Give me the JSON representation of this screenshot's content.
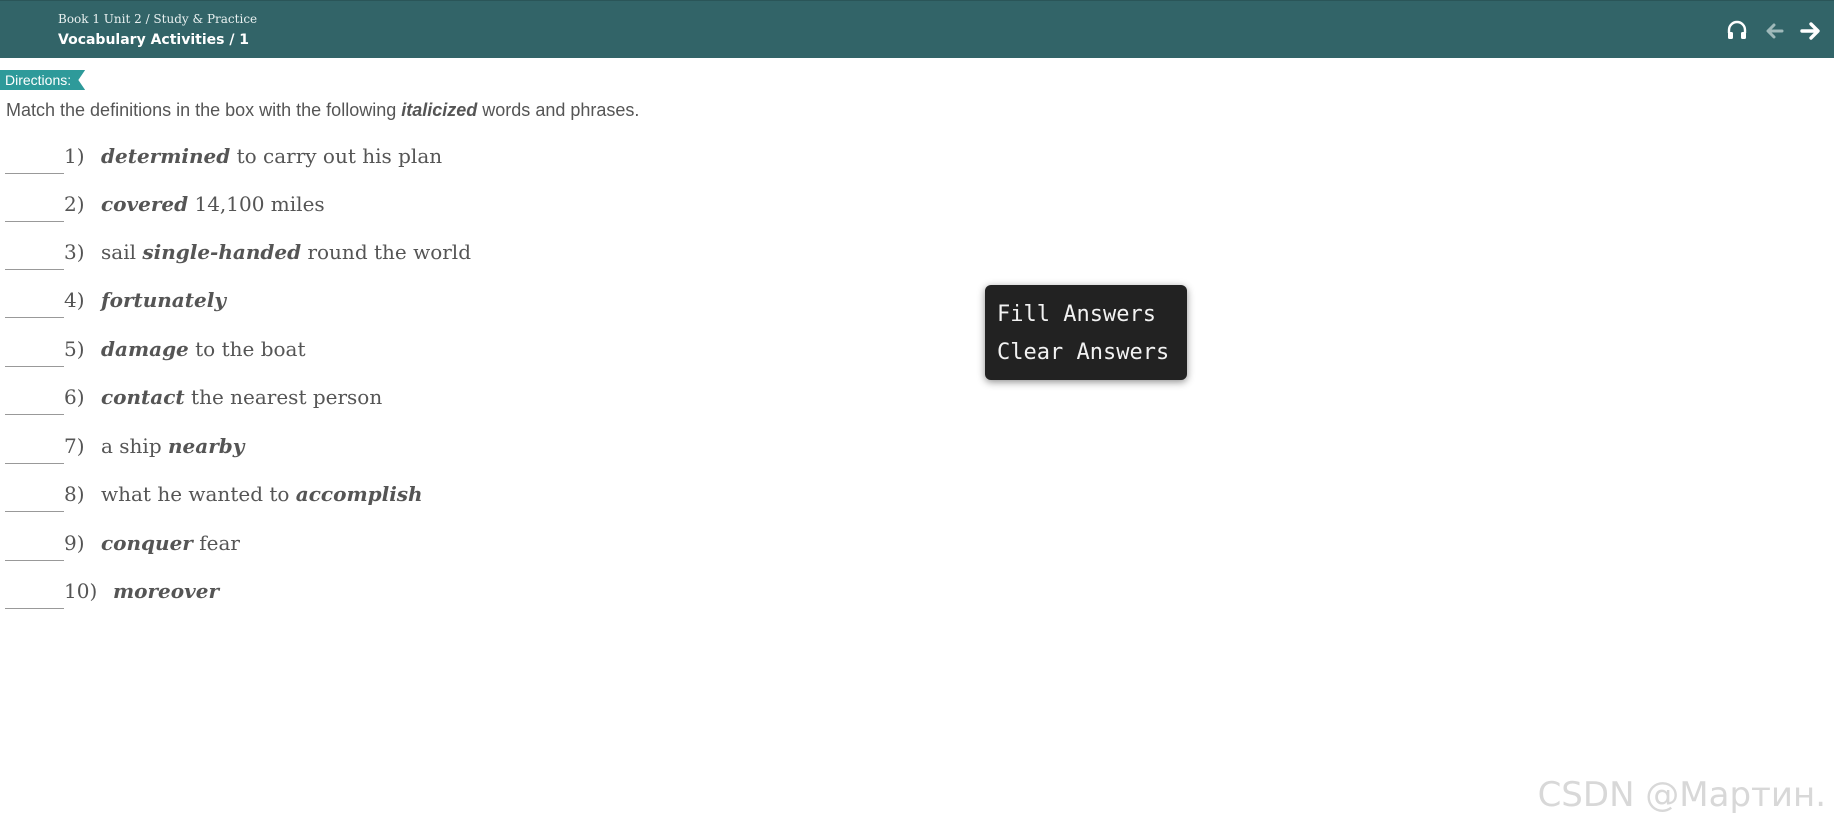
{
  "header": {
    "breadcrumb": "Book 1 Unit 2 / Study & Practice",
    "title": "Vocabulary Activities / 1",
    "icons": [
      "headphones-icon",
      "arrow-left-icon",
      "arrow-right-icon"
    ]
  },
  "directions": {
    "label": "Directions:",
    "text_before": "Match the definitions in the box with the following",
    "text_emph": "italicized",
    "text_after": "words and phrases."
  },
  "items": [
    {
      "num": "1)",
      "pre": "",
      "kw": "determined",
      "post": "to carry out his plan"
    },
    {
      "num": "2)",
      "pre": "",
      "kw": "covered",
      "post": "14,100 miles"
    },
    {
      "num": "3)",
      "pre": "sail",
      "kw": "single-handed",
      "post": "round the world"
    },
    {
      "num": "4)",
      "pre": "",
      "kw": "fortunately",
      "post": ""
    },
    {
      "num": "5)",
      "pre": "",
      "kw": "damage",
      "post": "to the boat"
    },
    {
      "num": "6)",
      "pre": "",
      "kw": "contact",
      "post": "the nearest person"
    },
    {
      "num": "7)",
      "pre": "a ship",
      "kw": "nearby",
      "post": ""
    },
    {
      "num": "8)",
      "pre": "what he wanted to",
      "kw": "accomplish",
      "post": ""
    },
    {
      "num": "9)",
      "pre": "",
      "kw": "conquer",
      "post": "fear"
    },
    {
      "num": "10)",
      "pre": "",
      "kw": "moreover",
      "post": ""
    }
  ],
  "context_menu": {
    "fill": "Fill Answers",
    "clear": "Clear Answers"
  },
  "watermark": "CSDN @Мартин.",
  "colors": {
    "header_bg": "#326468",
    "directions_tag": "#2e9a9a",
    "menu_bg": "#222222"
  }
}
